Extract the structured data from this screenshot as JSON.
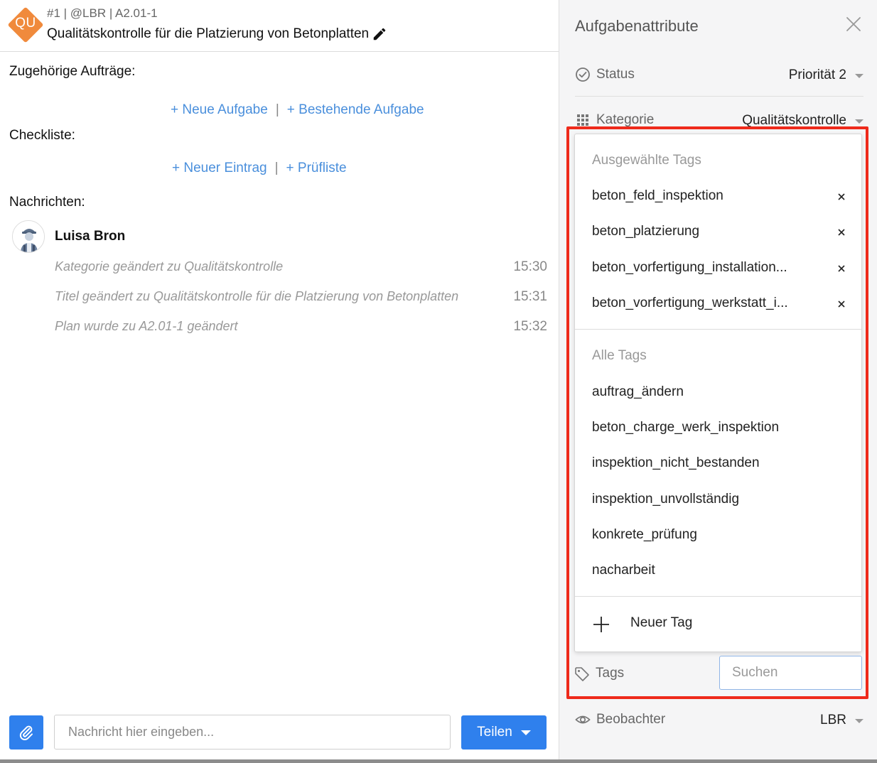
{
  "header": {
    "badge": "QU",
    "meta": "#1 | @LBR | A2.01-1",
    "title": "Qualitätskontrolle für die Platzierung von Betonplatten"
  },
  "related": {
    "label": "Zugehörige Aufträge:",
    "new_task": "+ Neue Aufgabe",
    "separator": "|",
    "existing_task": "+ Bestehende Aufgabe"
  },
  "checklist": {
    "label": "Checkliste:",
    "new_entry": "+ Neuer Eintrag",
    "separator": "|",
    "checklist": "+ Prüfliste"
  },
  "messages": {
    "label": "Nachrichten:",
    "author": "Luisa Bron",
    "items": [
      {
        "text": "Kategorie geändert zu Qualitätskontrolle",
        "time": "15:30"
      },
      {
        "text": "Titel geändert zu Qualitätskontrolle für die Platzierung von Betonplatten",
        "time": "15:31"
      },
      {
        "text": "Plan wurde zu A2.01-1 geändert",
        "time": "15:32"
      }
    ]
  },
  "composer": {
    "placeholder": "Nachricht hier eingeben...",
    "share_label": "Teilen"
  },
  "panel": {
    "title": "Aufgabenattribute",
    "status": {
      "label": "Status",
      "value": "Priorität 2"
    },
    "category": {
      "label": "Kategorie",
      "value": "Qualitätskontrolle"
    },
    "tags_label": "Tags",
    "search_placeholder": "Suchen",
    "observer": {
      "label": "Beobachter",
      "value": "LBR"
    }
  },
  "tag_popup": {
    "selected_heading": "Ausgewählte Tags",
    "selected": [
      "beton_feld_inspektion",
      "beton_platzierung",
      "beton_vorfertigung_installation...",
      "beton_vorfertigung_werkstatt_i..."
    ],
    "remove_symbol": "×",
    "all_heading": "Alle Tags",
    "all": [
      "auftrag_ändern",
      "beton_charge_werk_inspektion",
      "inspektion_nicht_bestanden",
      "inspektion_unvollständig",
      "konkrete_prüfung",
      "nacharbeit"
    ],
    "new_tag": "Neuer Tag"
  },
  "colors": {
    "accent": "#2f80ed",
    "link": "#4a8fdc",
    "badge": "#f08a3c",
    "highlight": "#ee2a1b"
  }
}
